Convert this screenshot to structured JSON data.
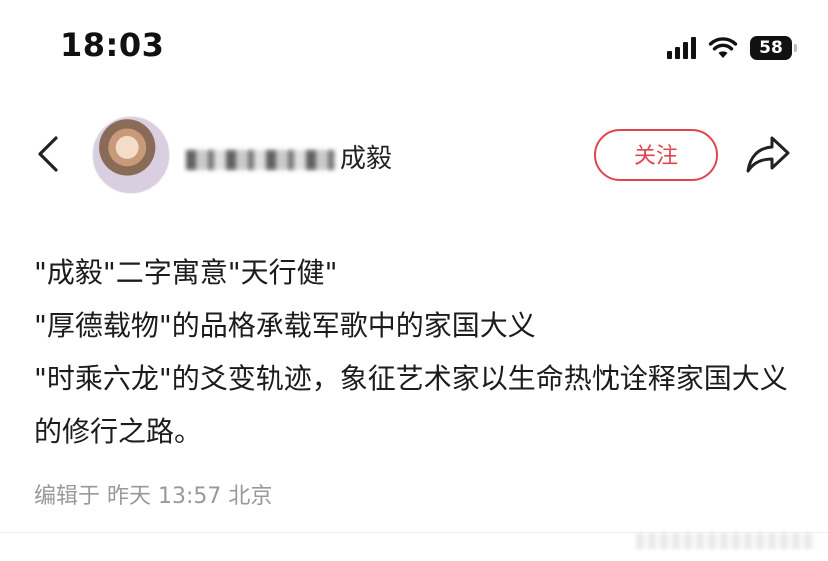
{
  "status_bar": {
    "time": "18:03",
    "battery": "58",
    "icons": [
      "cellular-signal-icon",
      "wifi-icon",
      "battery-icon"
    ]
  },
  "header": {
    "back_icon": "chevron-left-icon",
    "username_visible": "成毅",
    "follow_label": "关注",
    "share_icon": "share-arrow-icon",
    "accent_color": "#e0454f"
  },
  "post": {
    "lines": [
      "\"成毅\"二字寓意\"天行健\"",
      "\"厚德载物\"的品格承载军歌中的家国大义",
      "\"时乘六龙\"的爻变轨迹，象征艺术家以生命热忱诠释家国大义的修行之路。"
    ]
  },
  "meta": {
    "edit_info": "编辑于 昨天 13:57 北京"
  }
}
